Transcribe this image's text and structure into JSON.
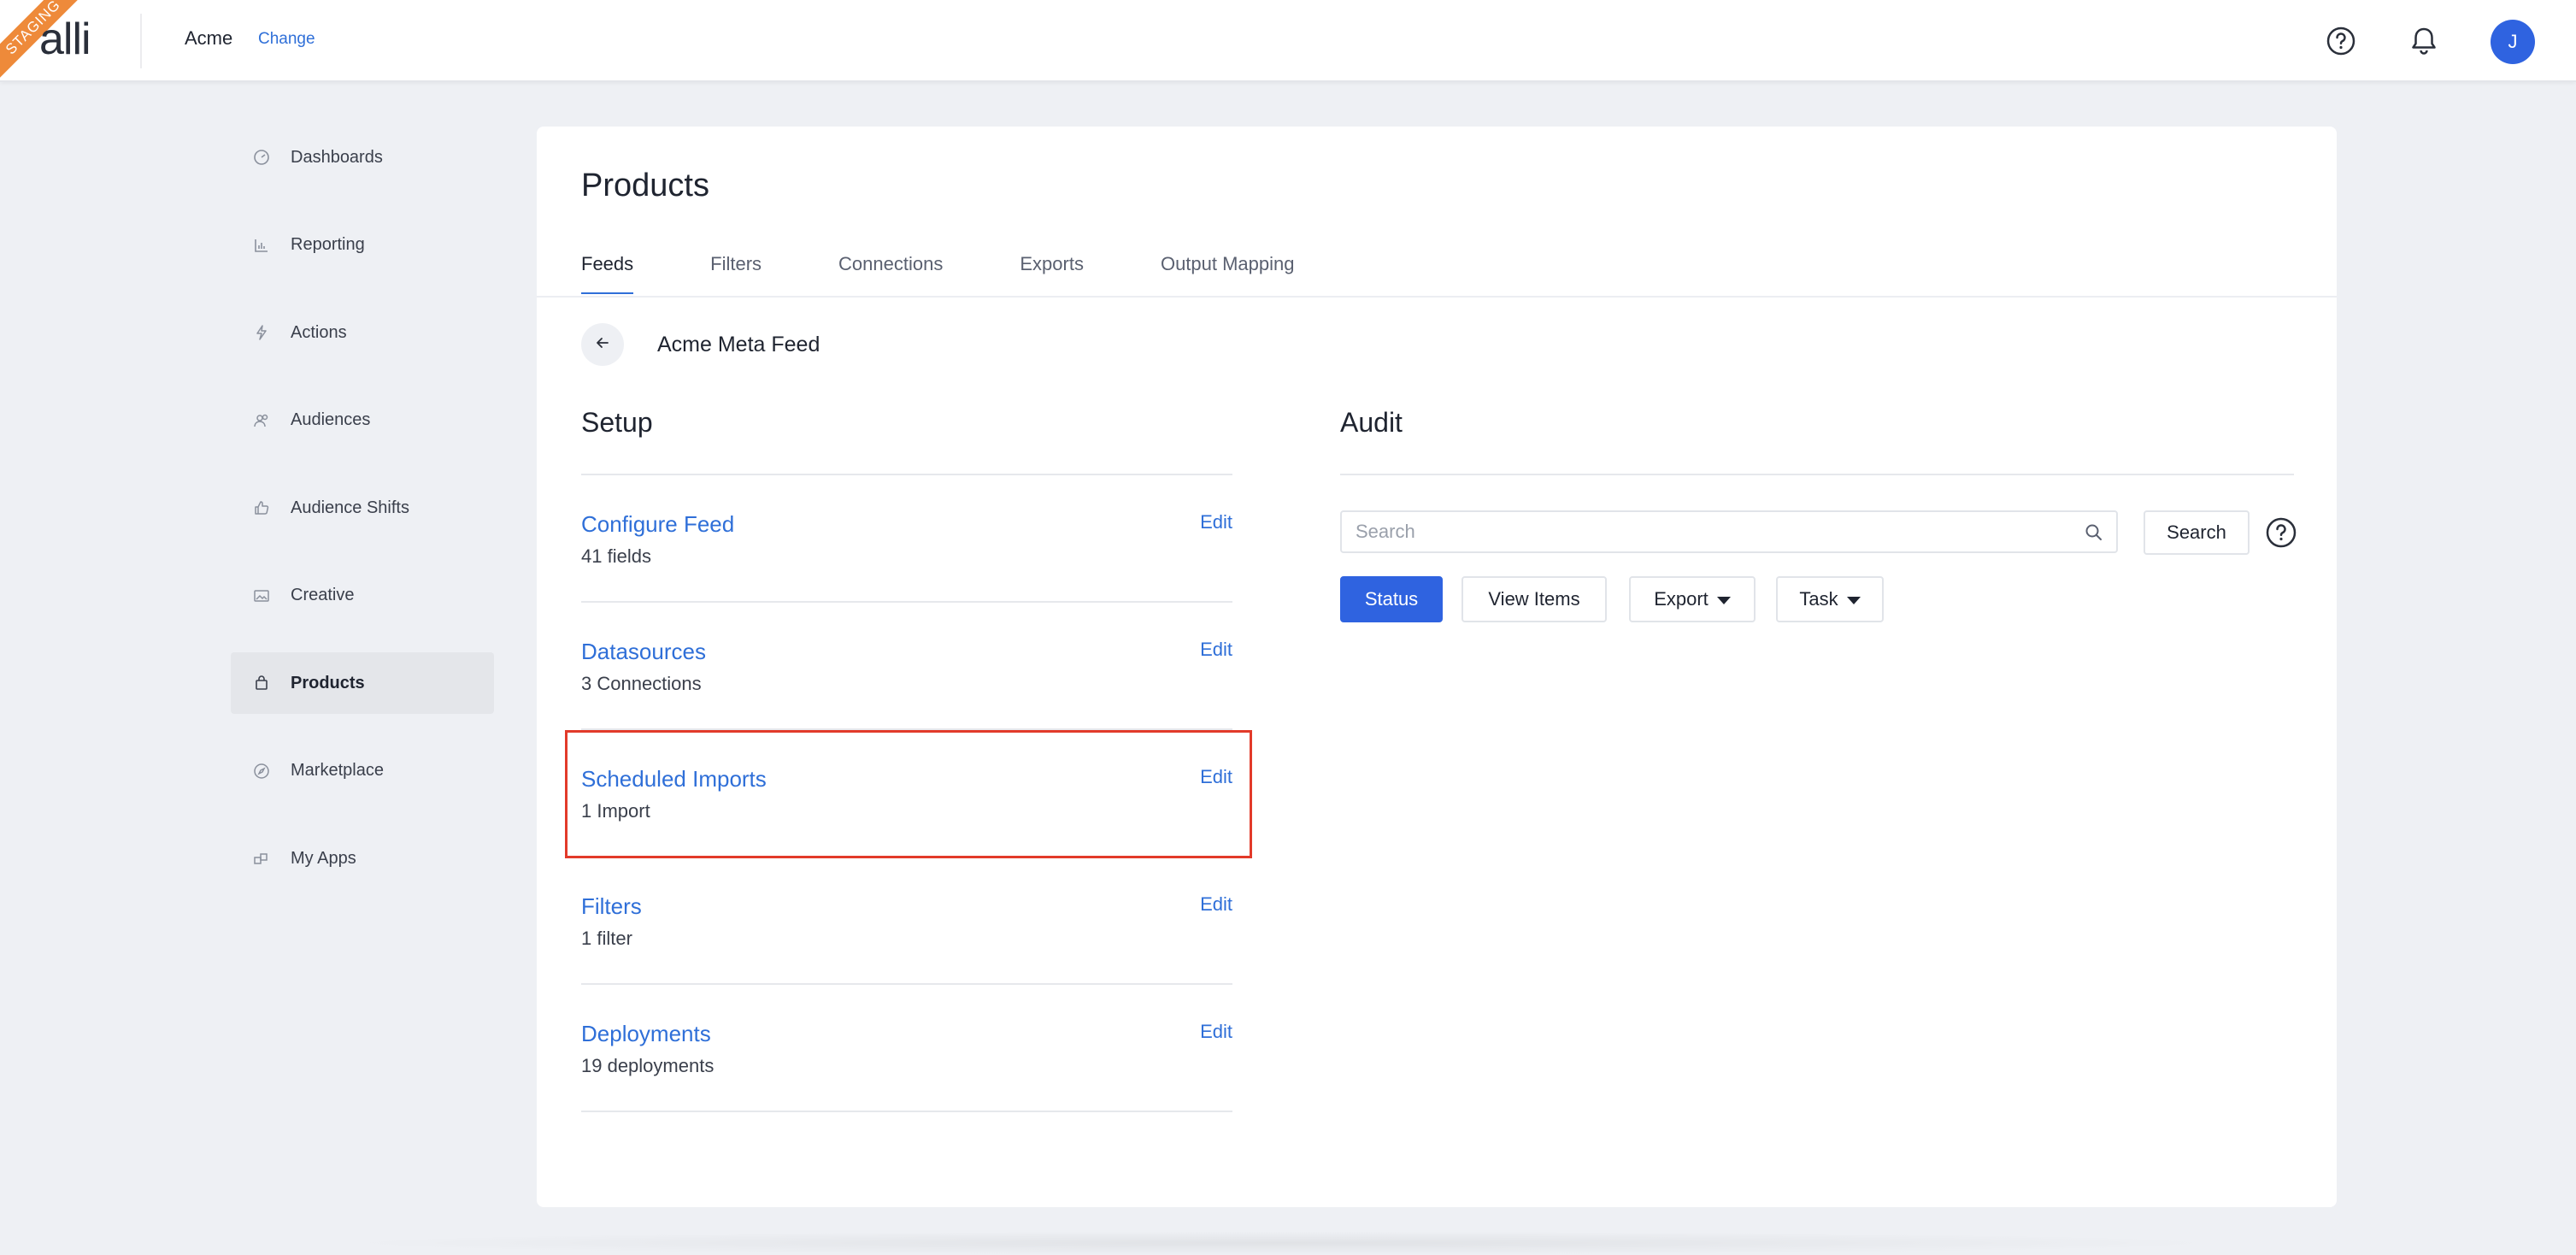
{
  "header": {
    "env_badge": "STAGING",
    "logo": "alli",
    "org_name": "Acme",
    "change_label": "Change",
    "help_icon": "help-circle-icon",
    "notifications_icon": "bell-icon",
    "avatar_initial": "J"
  },
  "sidebar": {
    "items": [
      {
        "label": "Dashboards",
        "icon": "dashboard-gauge-icon"
      },
      {
        "label": "Reporting",
        "icon": "bar-chart-icon"
      },
      {
        "label": "Actions",
        "icon": "lightning-bolt-icon"
      },
      {
        "label": "Audiences",
        "icon": "users-icon"
      },
      {
        "label": "Audience Shifts",
        "icon": "thumbs-up-icon"
      },
      {
        "label": "Creative",
        "icon": "image-icon"
      },
      {
        "label": "Products",
        "icon": "shopping-bag-icon",
        "active": true
      },
      {
        "label": "Marketplace",
        "icon": "compass-icon"
      },
      {
        "label": "My Apps",
        "icon": "apps-icon"
      }
    ]
  },
  "main": {
    "title": "Products",
    "tabs": [
      {
        "label": "Feeds",
        "active": true
      },
      {
        "label": "Filters"
      },
      {
        "label": "Connections"
      },
      {
        "label": "Exports"
      },
      {
        "label": "Output Mapping"
      }
    ],
    "feed_name": "Acme Meta Feed",
    "setup": {
      "title": "Setup",
      "rows": [
        {
          "title": "Configure Feed",
          "subtitle": "41 fields",
          "edit": "Edit"
        },
        {
          "title": "Datasources",
          "subtitle": "3 Connections",
          "edit": "Edit"
        },
        {
          "title": "Scheduled Imports",
          "subtitle": "1 Import",
          "edit": "Edit",
          "highlighted": true
        },
        {
          "title": "Filters",
          "subtitle": "1 filter",
          "edit": "Edit"
        },
        {
          "title": "Deployments",
          "subtitle": "19 deployments",
          "edit": "Edit"
        }
      ]
    },
    "audit": {
      "title": "Audit",
      "search_placeholder": "Search",
      "search_button": "Search",
      "buttons": {
        "status": "Status",
        "view_items": "View Items",
        "export": "Export",
        "task": "Task"
      }
    }
  },
  "colors": {
    "accent": "#2f63e0",
    "link": "#2f6fd8",
    "highlight": "#e23a2a",
    "staging_badge": "#ee8a3a"
  }
}
